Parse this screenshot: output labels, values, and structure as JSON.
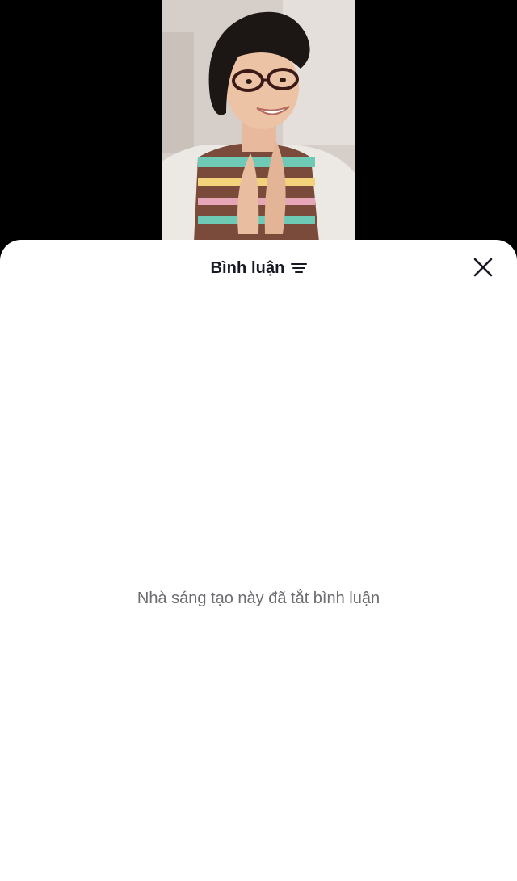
{
  "video": {
    "thumbnail_icon": "video-thumbnail-image"
  },
  "comments_sheet": {
    "title": "Bình luận",
    "sort_icon": "sort-lines-icon",
    "close_icon": "close-icon",
    "empty_message": "Nhà sáng tạo này đã tắt bình luận"
  },
  "colors": {
    "background": "#000000",
    "sheet": "#ffffff",
    "title_text": "#161823",
    "muted_text": "#6b6b70"
  }
}
